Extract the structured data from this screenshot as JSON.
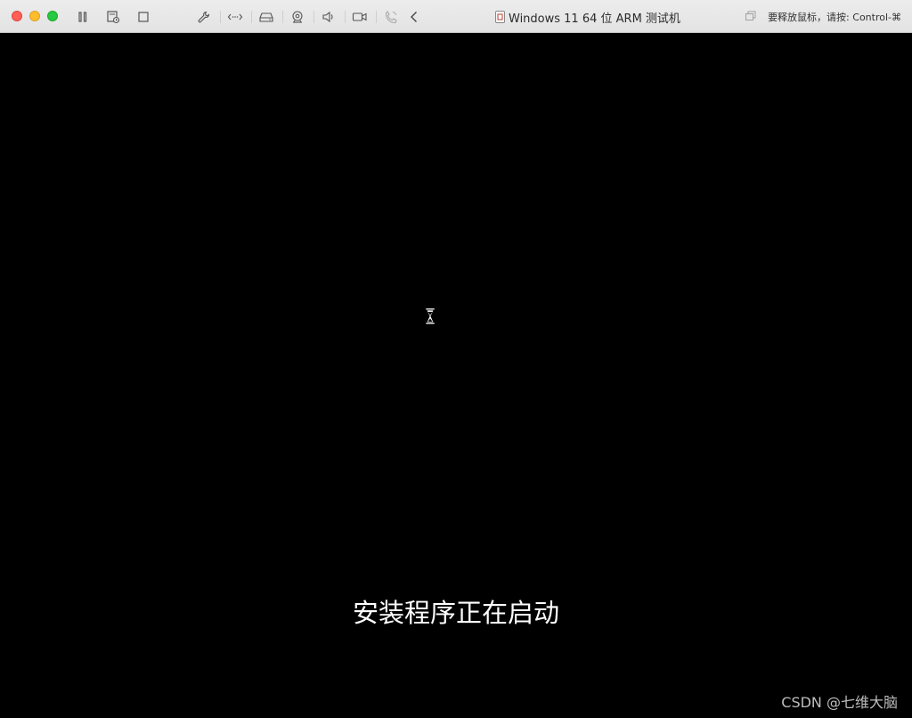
{
  "window": {
    "title": "Windows 11 64 位 ARM 测试机",
    "release_hint": "要释放鼠标，请按: Control-⌘"
  },
  "toolbar": {
    "icons": [
      "pause-icon",
      "snapshot-icon",
      "stop-icon",
      "wrench-icon",
      "network-icon",
      "disk-icon",
      "camera-lock-icon",
      "speaker-icon",
      "video-icon",
      "phone-icon",
      "back-icon"
    ]
  },
  "screen": {
    "status": "安装程序正在启动",
    "watermark": "CSDN @七维大脑",
    "cursor": "hourglass-icon"
  },
  "colors": {
    "close": "#fe5f57",
    "minimize": "#febc2e",
    "maximize": "#28c840",
    "screen_bg": "#000000",
    "status_text": "#ffffff"
  }
}
